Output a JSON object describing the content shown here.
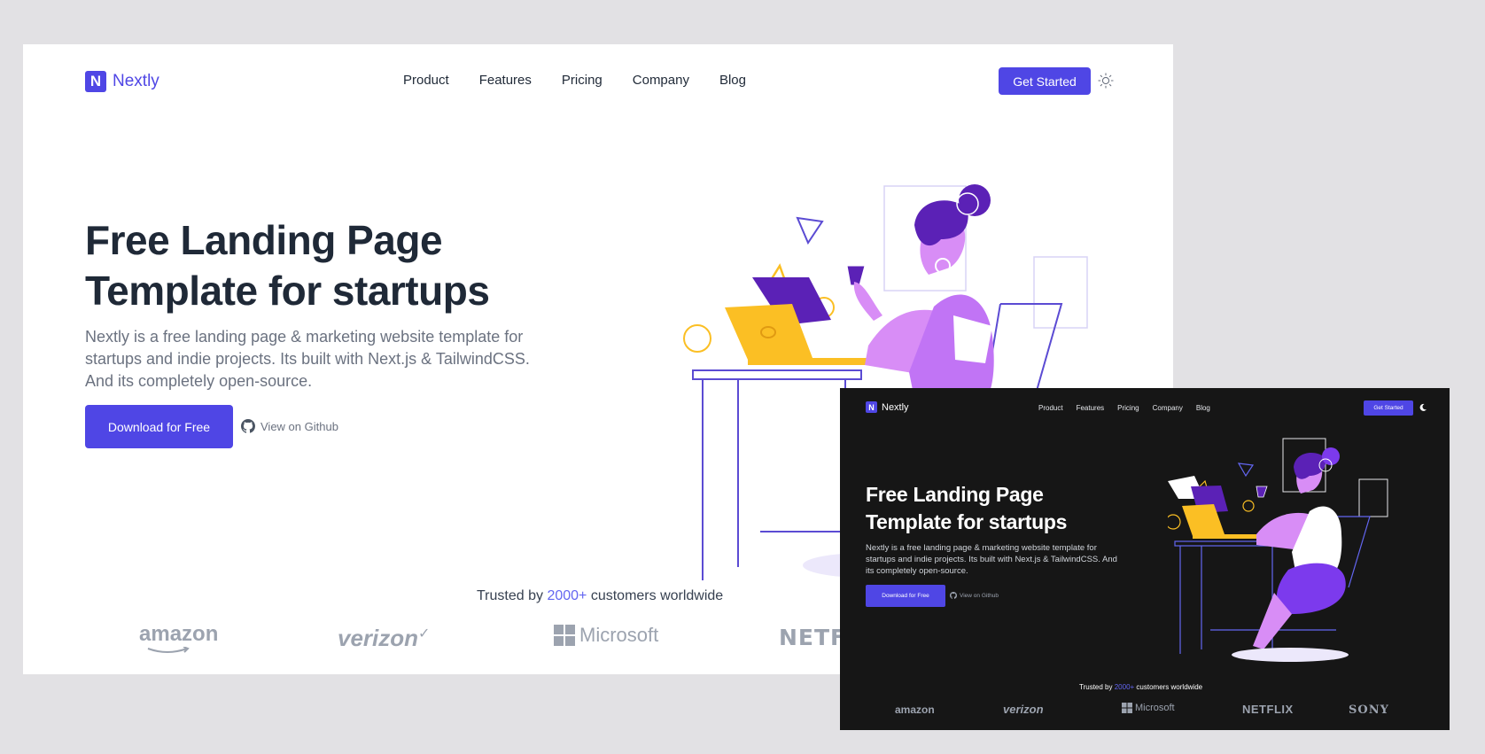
{
  "light": {
    "logo": {
      "mark": "N",
      "name": "Nextly"
    },
    "nav": [
      "Product",
      "Features",
      "Pricing",
      "Company",
      "Blog"
    ],
    "cta": "Get Started",
    "theme_toggle_icon": "sun-icon",
    "hero": {
      "title_line1": "Free Landing Page",
      "title_line2": "Template for startups",
      "description": "Nextly is a free landing page & marketing website template for startups and indie projects. Its built with Next.js & TailwindCSS. And its completely open-source.",
      "download": "Download for Free",
      "github": "View on Github"
    },
    "trusted": {
      "pre": "Trusted by ",
      "count": "2000+",
      "post": " customers worldwide"
    },
    "brands": [
      "amazon",
      "verizon",
      "Microsoft",
      "NETFLI"
    ]
  },
  "dark": {
    "logo": {
      "mark": "N",
      "name": "Nextly"
    },
    "nav": [
      "Product",
      "Features",
      "Pricing",
      "Company",
      "Blog"
    ],
    "cta": "Get Started",
    "theme_toggle_icon": "moon-icon",
    "hero": {
      "title_line1": "Free Landing Page",
      "title_line2": "Template for startups",
      "description": "Nextly is a free landing page & marketing website template for startups and indie projects. Its built with Next.js & TailwindCSS. And its completely open-source.",
      "download": "Download for Free",
      "github": "View on Github"
    },
    "trusted": {
      "pre": "Trusted by ",
      "count": "2000+",
      "post": " customers worldwide"
    },
    "brands": [
      "amazon",
      "verizon",
      "Microsoft",
      "NETFLIX",
      "SONY"
    ]
  },
  "colors": {
    "accent": "#4f46e5",
    "dark_bg": "#161616",
    "light_bg": "#ffffff",
    "purple": "#c084fc",
    "deep_purple": "#5b21b6",
    "yellow": "#fbbf24"
  }
}
